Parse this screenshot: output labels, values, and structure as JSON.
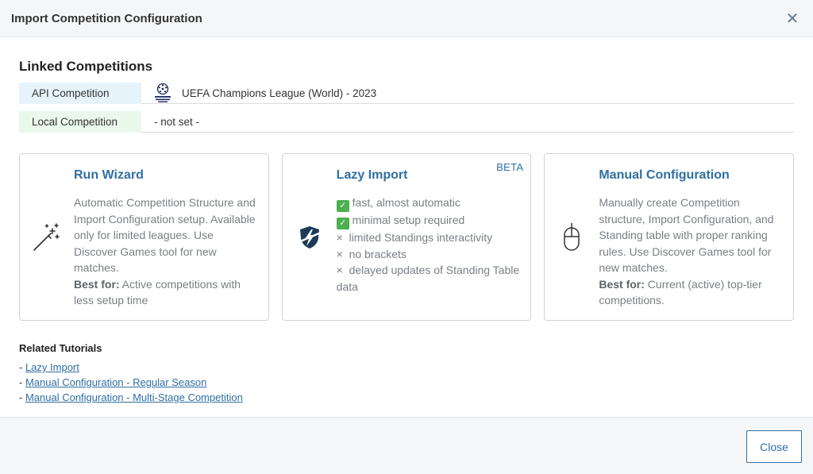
{
  "header": {
    "title": "Import Competition Configuration",
    "close_icon": "close-icon"
  },
  "linked": {
    "title": "Linked Competitions",
    "rows": [
      {
        "label": "API Competition",
        "value": "UEFA Champions League (World) - 2023",
        "logo_text": "UEFA CHAMPIONS LEAGUE"
      },
      {
        "label": "Local Competition",
        "value": "- not set -"
      }
    ]
  },
  "cards": [
    {
      "title": "Run Wizard",
      "icon": "magic-wand-icon",
      "text": "Automatic Competition Structure and Import Configuration setup. Available only for limited leagues. Use Discover Games tool for new matches.",
      "best_label": "Best for:",
      "best_text": " Active competitions with less setup time"
    },
    {
      "title": "Lazy Import",
      "badge": "BETA",
      "icon": "shield-bolt-icon",
      "items": [
        {
          "mark": "check",
          "text": "fast, almost automatic"
        },
        {
          "mark": "check",
          "text": "minimal setup required"
        },
        {
          "mark": "cross",
          "text": "limited Standings interactivity"
        },
        {
          "mark": "cross",
          "text": "no brackets"
        },
        {
          "mark": "cross",
          "text": "delayed updates of Standing Table data"
        }
      ]
    },
    {
      "title": "Manual Configuration",
      "icon": "mouse-icon",
      "text": "Manually create Competition structure, Import Configuration, and Standing table with proper ranking rules. Use Discover Games tool for new matches.",
      "best_label": "Best for:",
      "best_text": " Current (active) top-tier competitions."
    }
  ],
  "tutorials": {
    "title": "Related Tutorials",
    "prefix": "- ",
    "links": [
      "Lazy Import",
      "Manual Configuration - Regular Season",
      "Manual Configuration - Multi-Stage Competition"
    ]
  },
  "footer": {
    "close_label": "Close"
  },
  "colors": {
    "accent": "#2f6fa3",
    "api_bg": "#e7f3fb",
    "local_bg": "#eaf8ec",
    "check": "#4caf50"
  }
}
